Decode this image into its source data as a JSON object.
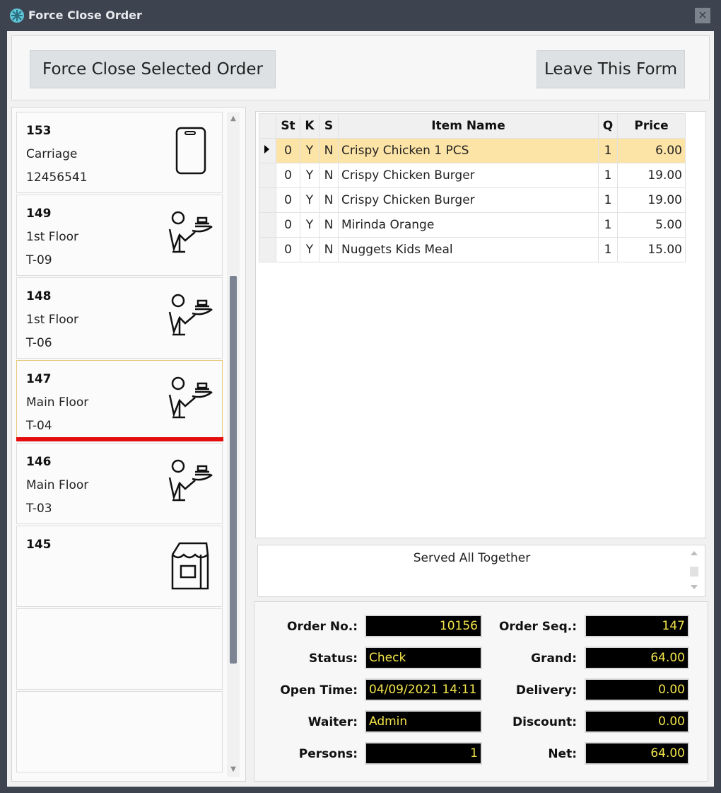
{
  "window": {
    "title": "Force Close Order"
  },
  "toolbar": {
    "force_close_label": "Force Close Selected Order",
    "leave_label": "Leave This Form"
  },
  "orders": [
    {
      "number": "153",
      "location": "Carriage",
      "detail": "12456541",
      "icon": "phone-icon"
    },
    {
      "number": "149",
      "location": "1st Floor",
      "detail": "T-09",
      "icon": "waiter-icon"
    },
    {
      "number": "148",
      "location": "1st Floor",
      "detail": "T-06",
      "icon": "waiter-icon"
    },
    {
      "number": "147",
      "location": "Main Floor",
      "detail": "T-04",
      "icon": "waiter-icon"
    },
    {
      "number": "146",
      "location": "Main Floor",
      "detail": "T-03",
      "icon": "waiter-icon"
    },
    {
      "number": "145",
      "location": "",
      "detail": "",
      "icon": "takeaway-bag-icon"
    }
  ],
  "grid": {
    "headers": {
      "st": "St",
      "k": "K",
      "s": "S",
      "name": "Item Name",
      "q": "Q",
      "price": "Price"
    },
    "rows": [
      {
        "st": "0",
        "k": "Y",
        "s": "N",
        "name": "Crispy Chicken 1 PCS",
        "q": "1",
        "price": "6.00"
      },
      {
        "st": "0",
        "k": "Y",
        "s": "N",
        "name": "Crispy Chicken Burger",
        "q": "1",
        "price": "19.00"
      },
      {
        "st": "0",
        "k": "Y",
        "s": "N",
        "name": "Crispy Chicken Burger",
        "q": "1",
        "price": "19.00"
      },
      {
        "st": "0",
        "k": "Y",
        "s": "N",
        "name": "Mirinda Orange",
        "q": "1",
        "price": "5.00"
      },
      {
        "st": "0",
        "k": "Y",
        "s": "N",
        "name": "Nuggets Kids Meal",
        "q": "1",
        "price": "15.00"
      }
    ]
  },
  "note": "Served All Together",
  "info": {
    "order_no_label": "Order No.:",
    "order_no": "10156",
    "status_label": "Status:",
    "status": "Check",
    "open_time_label": "Open Time:",
    "open_time": "04/09/2021 14:11",
    "waiter_label": "Waiter:",
    "waiter": "Admin",
    "persons_label": "Persons:",
    "persons": "1",
    "order_seq_label": "Order Seq.:",
    "order_seq": "147",
    "grand_label": "Grand:",
    "grand": "64.00",
    "delivery_label": "Delivery:",
    "delivery": "0.00",
    "discount_label": "Discount:",
    "discount": "0.00",
    "net_label": "Net:",
    "net": "64.00"
  },
  "colors": {
    "title_bar": "#3d4450",
    "selected_row": "#fce3a6",
    "selected_marker": "#e40d0d",
    "value_text": "#f2e44a",
    "value_bg": "#000000"
  }
}
